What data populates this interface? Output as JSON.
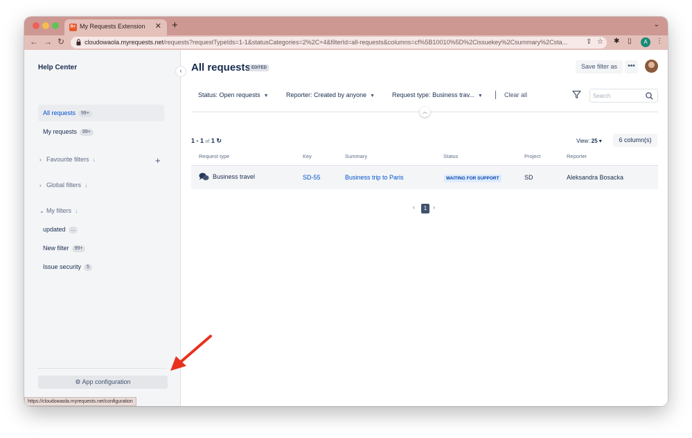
{
  "browser": {
    "tab_title": "My Requests Extension",
    "tab_favicon_text": "R+",
    "url_host": "cloudowaola.myrequests.net",
    "url_path": "/requests?requestTypeIds=1-1&statusCategories=2%2C+4&filterId=all-requests&columns=cf%5B10010%5D%2Cissuekey%2Csummary%2Csta...",
    "profile_initial": "A",
    "status_bar_url": "https://cloudowaola.myrequests.net/configuration"
  },
  "sidebar": {
    "title": "Help Center",
    "items": [
      {
        "label": "All requests",
        "badge": "99+"
      },
      {
        "label": "My requests",
        "badge": "99+"
      }
    ],
    "sections": {
      "favourite": "Favourite filters",
      "global": "Global filters",
      "my": "My filters"
    },
    "my_filters": [
      {
        "label": "updated",
        "badge": "..."
      },
      {
        "label": "New filter",
        "badge": "99+"
      },
      {
        "label": "Issue security",
        "badge": "5"
      }
    ],
    "app_config_label": "App configuration"
  },
  "header": {
    "title": "All requests",
    "edited_badge": "EDITED",
    "save_filter_label": "Save filter as",
    "more_label": "•••"
  },
  "filters": {
    "status_prefix": "Status:",
    "status_value": "Open requests",
    "reporter_prefix": "Reporter:",
    "reporter_value": "Created by anyone",
    "type_prefix": "Request type:",
    "type_value": "Business trav...",
    "clear_all": "Clear all",
    "search_placeholder": "Search"
  },
  "results": {
    "range": "1 - 1",
    "of": "of",
    "total": "1",
    "view_label": "View:",
    "view_value": "25",
    "columns_label": "6 column(s)"
  },
  "table": {
    "headers": [
      "Request type",
      "Key",
      "Summary",
      "Status",
      "Project",
      "Reporter"
    ],
    "rows": [
      {
        "request_type": "Business travel",
        "key": "SD-55",
        "summary": "Business trip to Paris",
        "status": "WAITING FOR SUPPORT",
        "project": "SD",
        "reporter": "Aleksandra Bosacka"
      }
    ]
  },
  "pagination": {
    "current": "1",
    "prev": "‹",
    "next": "›"
  },
  "colors": {
    "accent": "#0052cc",
    "annotation_arrow": "#e8321e",
    "browser_chrome": "#cd9892"
  }
}
